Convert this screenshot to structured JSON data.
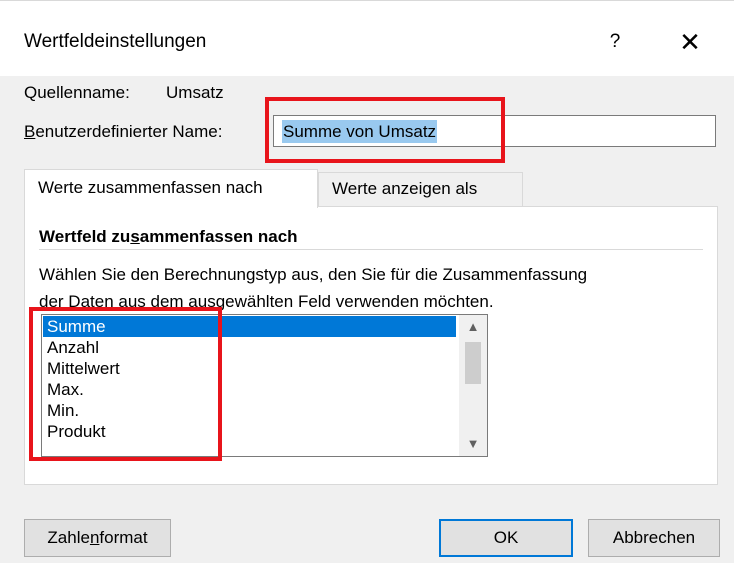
{
  "dialog": {
    "title": "Wertfeldeinstellungen",
    "help_label": "?",
    "close_label": "✕"
  },
  "source": {
    "label": "Quellenname:",
    "value": "Umsatz"
  },
  "custom_name": {
    "label_prefix": "B",
    "label_rest": "enutzerdefinierter Name:",
    "value": "Summe von Umsatz"
  },
  "tabs": [
    {
      "label": "Werte zusammenfassen nach",
      "active": true
    },
    {
      "label": "Werte anzeigen als",
      "active": false
    }
  ],
  "section": {
    "title_a": "Wertfeld zu",
    "title_u": "s",
    "title_b": "ammenfassen nach",
    "description_line1": "Wählen Sie den Berechnungstyp aus, den Sie für die Zusammenfassung",
    "description_line2": "der Daten aus dem ausgewählten Feld verwenden möchten."
  },
  "calc_types": {
    "items": [
      "Summe",
      "Anzahl",
      "Mittelwert",
      "Max.",
      "Min.",
      "Produkt"
    ],
    "selected": "Summe",
    "scroll_up": "▲",
    "scroll_down": "▼"
  },
  "buttons": {
    "number_format_a": "Zahle",
    "number_format_u": "n",
    "number_format_b": "format",
    "ok": "OK",
    "cancel": "Abbrechen"
  },
  "colors": {
    "accent": "#0078d7",
    "highlight_box": "#e8141b",
    "selection_text_bg": "#99c9ef"
  }
}
